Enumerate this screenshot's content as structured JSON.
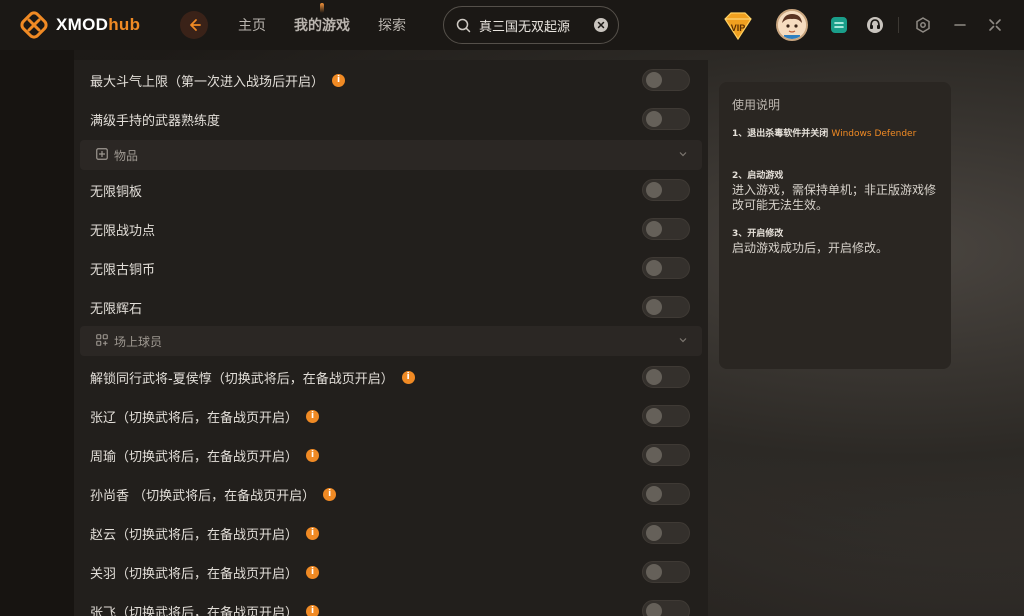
{
  "brand": {
    "name_main": "XMOD",
    "name_accent": "hub",
    "accent_color": "#f08a24"
  },
  "nav": {
    "items": [
      {
        "label": "主页",
        "active": false
      },
      {
        "label": "我的游戏",
        "active": true
      },
      {
        "label": "探索",
        "active": false
      }
    ]
  },
  "search": {
    "value": "真三国无双起源"
  },
  "header_icons": [
    "vip-badge-icon",
    "avatar",
    "green-app-icon",
    "support-icon",
    "settings-icon",
    "minimize-icon",
    "close-icon"
  ],
  "vip": {
    "label": "VIP"
  },
  "rows_top": [
    {
      "label": "最大斗气上限（第一次进入战场后开启）",
      "info": true,
      "on": false
    },
    {
      "label": "满级手持的武器熟练度",
      "info": false,
      "on": false
    }
  ],
  "section_items": {
    "label": "物品"
  },
  "rows_items": [
    {
      "label": "无限铜板",
      "info": false,
      "on": false
    },
    {
      "label": "无限战功点",
      "info": false,
      "on": false
    },
    {
      "label": "无限古铜币",
      "info": false,
      "on": false
    },
    {
      "label": "无限辉石",
      "info": false,
      "on": false
    }
  ],
  "section_players": {
    "label": "场上球员"
  },
  "rows_players": [
    {
      "label": "解锁同行武将-夏侯惇（切换武将后，在备战页开启）",
      "info": true,
      "on": false
    },
    {
      "label": "张辽（切换武将后，在备战页开启）",
      "info": true,
      "on": false
    },
    {
      "label": "周瑜（切换武将后，在备战页开启）",
      "info": true,
      "on": false
    },
    {
      "label": "孙尚香 （切换武将后，在备战页开启）",
      "info": true,
      "on": false
    },
    {
      "label": "赵云（切换武将后，在备战页开启）",
      "info": true,
      "on": false
    },
    {
      "label": "关羽（切换武将后，在备战页开启）",
      "info": true,
      "on": false
    },
    {
      "label": "张飞（切换武将后，在备战页开启）",
      "info": true,
      "on": false
    }
  ],
  "instructions": {
    "title": "使用说明",
    "steps": [
      {
        "head": "1、退出杀毒软件并关闭",
        "highlight": "Windows Defender",
        "body": ""
      },
      {
        "head": "2、启动游戏",
        "highlight": "",
        "body": "进入游戏，需保持单机；非正版游戏修改可能无法生效。"
      },
      {
        "head": "3、开启修改",
        "highlight": "",
        "body": "启动游戏成功后，开启修改。"
      }
    ]
  },
  "info_glyph": "i"
}
